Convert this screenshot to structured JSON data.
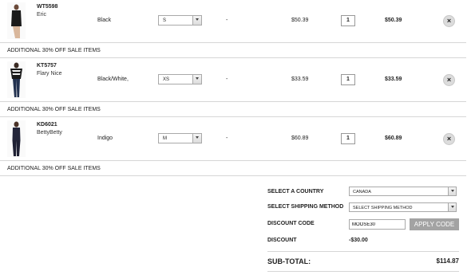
{
  "cart": {
    "items": [
      {
        "sku": "WT5598",
        "name": "Eric",
        "color": "Black",
        "size": "S",
        "option": "-",
        "price": "$50.39",
        "qty": "1",
        "total": "$50.39",
        "promo": "ADDITIONAL 30% OFF SALE ITEMS",
        "remove": "×"
      },
      {
        "sku": "KT5757",
        "name": "Flary Nice",
        "color": "Black/White,",
        "size": "XS",
        "option": "-",
        "price": "$33.59",
        "qty": "1",
        "total": "$33.59",
        "promo": "ADDITIONAL 30% OFF SALE ITEMS",
        "remove": "×"
      },
      {
        "sku": "KD6021",
        "name": "BettyBetty",
        "color": "Indigo",
        "size": "M",
        "option": "-",
        "price": "$60.89",
        "qty": "1",
        "total": "$60.89",
        "promo": "ADDITIONAL 30% OFF SALE ITEMS",
        "remove": "×"
      }
    ]
  },
  "summary": {
    "country_label": "SELECT A COUNTRY",
    "country_value": "CANADA",
    "shipping_label": "SELECT SHIPPING METHOD",
    "shipping_value": "SELECT SHIPPING METHOD",
    "discount_code_label": "DISCOUNT CODE",
    "discount_code_value": "MOOSE30",
    "apply_label": "APPLY CODE",
    "discount_label": "DISCOUNT",
    "discount_value": "-$30.00",
    "subtotal_label": "SUB-TOTAL:",
    "subtotal_value": "$114.87"
  },
  "icons": {
    "select_arrow": "chevron-down-icon",
    "remove": "close-icon"
  },
  "colors": {
    "apply_button": "#a3a3a3",
    "remove_button": "#dcdcdc",
    "divider": "#d6d6d6"
  }
}
